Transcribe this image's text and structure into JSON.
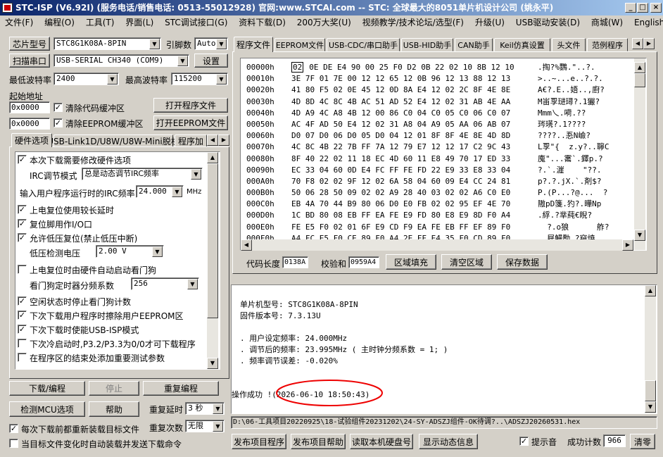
{
  "window": {
    "title": "STC-ISP (V6.92I) (服务电话/销售电话: 0513-55012928) 官网:www.STCAI.com  -- STC: 全球最大的8051单片机设计公司 (姚永平)",
    "min": "_",
    "max": "□",
    "close": "×"
  },
  "menu": [
    "文件(F)",
    "编程(O)",
    "工具(T)",
    "界面(L)",
    "STC调试接口(G)",
    "资料下载(D)",
    "200万大奖(U)",
    "视频教学/技术论坛/选型(F)",
    "升级(U)",
    "USB驱动安装(D)",
    "商城(W)",
    "English"
  ],
  "left": {
    "chip_btn": "芯片型号",
    "chip_value": "STC8G1K08A-8PIN",
    "pins_label": "引脚数",
    "pins_value": "Auto",
    "scan_btn": "扫描串口",
    "port_value": "USB-SERIAL CH340 (COM9)",
    "settings_btn": "设置",
    "min_baud_label": "最低波特率",
    "min_baud": "2400",
    "max_baud_label": "最高波特率",
    "max_baud": "115200",
    "start_addr_label": "起始地址",
    "addr1": "0x0000",
    "clear_code": "清除代码缓冲区",
    "open_prog": "打开程序文件",
    "addr2": "0x0000",
    "clear_eeprom": "清除EEPROM缓冲区",
    "open_eeprom": "打开EEPROM文件",
    "tabs": [
      "硬件选项",
      "USB-Link1D/U8W/U8W-Mini脱机",
      "程序加"
    ],
    "opt_modify": "本次下载需要修改硬件选项",
    "irc_mode_label": "IRC调节模式",
    "irc_mode": "总是动态调节IRC频率",
    "irc_freq_label": "输入用户程序运行时的IRC频率",
    "irc_freq": "24.000",
    "mhz": "MHz",
    "opt_long_delay": "上电复位使用较长延时",
    "opt_reset_io": "复位脚用作I/O口",
    "opt_low_volt": "允许低压复位(禁止低压中断)",
    "low_volt_label": "低压检测电压",
    "low_volt": "2.00 V",
    "opt_wdt": "上电复位时由硬件自动启动看门狗",
    "wdt_label": "看门狗定时器分频系数",
    "wdt_value": "256",
    "opt_idle_wdt": "空闲状态时停止看门狗计数",
    "opt_erase_eeprom": "下次下载用户程序时擦除用户EEPROM区",
    "opt_usb_isp": "下次下载时使能USB-ISP模式",
    "opt_cold": "下次冷启动时,P3.2/P3.3为0/0才可下载程序",
    "opt_end_param": "在程序区的结束处添加重要测试参数",
    "download_btn": "下载/编程",
    "stop_btn": "停止",
    "redownload_btn": "重复编程",
    "check_mcu_btn": "检测MCU选项",
    "help_btn": "帮助",
    "repeat_delay_label": "重复延时",
    "repeat_delay": "3 秒",
    "repeat_count_label": "重复次数",
    "repeat_count": "无限",
    "reload_each": "每次下载前都重新装载目标文件",
    "auto_load": "当目标文件变化时自动装载并发送下载命令"
  },
  "right": {
    "tabs": [
      "程序文件",
      "EEPROM文件",
      "USB-CDC/串口助手",
      "USB-HID助手",
      "CAN助手",
      "Keil仿真设置",
      "头文件",
      "范例程序"
    ],
    "hex_rows": [
      {
        "addr": "00000h",
        "bytes": "0E DE E4 90 00 25 F0 D2 0B 22 02 10 8B 12 10",
        "first": "02",
        "ascii": ".掏?%鸚.\"..?."
      },
      {
        "addr": "00010h",
        "bytes": "3E 7F 01 7E 00 12 12 65 12 0B 96 12 13 88 12 13",
        "ascii": ">..~...e..?.?."
      },
      {
        "addr": "00020h",
        "bytes": "41 80 F5 02 0E 45 12 0D 8A E4 12 02 2C 8F 4E 8E",
        "ascii": "A€?.E..娪..,廚?"
      },
      {
        "addr": "00030h",
        "bytes": "4D 8D 4C 8C 4B AC 51 AD 52 E4 12 02 31 AB 4E AA",
        "ascii": "M峀孠琎璕?.1玁?"
      },
      {
        "addr": "00040h",
        "bytes": "4D A9 4C A8 4B 12 00 86 C0 04 C0 05 C0 06 C0 07",
        "ascii": "Mmm乀.嗬.??"
      },
      {
        "addr": "00050h",
        "bytes": "AC 4F AD 50 E4 12 02 31 A8 04 A9 05 AA 06 AB 07",
        "ascii": "琌璓?.1????"
      },
      {
        "addr": "00060h",
        "bytes": "D0 07 D0 06 D0 05 D0 04 12 01 8F 8F 4E 8E 4D 8D",
        "ascii": "????..忢N嶮?"
      },
      {
        "addr": "00070h",
        "bytes": "4C 8C 4B 22 7B FF 7A 12 79 E7 12 12 17 C2 9C 43",
        "ascii": "L孠\"{  z.y?..聹C"
      },
      {
        "addr": "00080h",
        "bytes": "8F 40 22 02 11 18 EC 4D 60 11 E8 49 70 17 ED 33",
        "ascii": "廆\"...霱`.鐸p.?"
      },
      {
        "addr": "00090h",
        "bytes": "EC 33 04 60 0D E4 FC FF FE FD 22 E9 33 E8 33 04",
        "ascii": "?.`.漄    \"??."
      },
      {
        "addr": "000A0h",
        "bytes": "70 F8 02 02 9F 12 02 6A 58 04 60 09 E4 CC 24 81",
        "ascii": "p?.?.jX.`.剤$?"
      },
      {
        "addr": "000B0h",
        "bytes": "50 06 28 50 09 02 02 A9 28 40 03 02 02 A6 C0 E0",
        "ascii": "P.(P...?@...  ?"
      },
      {
        "addr": "000C0h",
        "bytes": "EB 4A 70 44 B9 80 06 D0 E0 FB 02 02 95 EF 4E 70",
        "ascii": "隞pD箋.犳?.曄Np"
      },
      {
        "addr": "000D0h",
        "bytes": "1C BD 80 08 EB FF EA FE E9 FD 80 E8 E9 8D F0 A4",
        "ascii": ".綒.?丵蒓€睨?"
      },
      {
        "addr": "000E0h",
        "bytes": "FE E5 F0 02 01 6F E9 CD F9 EA FE EB FF EF 89 F0",
        "ascii": "  ?.o狼      舴?"
      },
      {
        "addr": "000F0h",
        "bytes": "A4 FC E5 F0 CE 89 F0 A4 2E FF E4 35 F0 CD 89 F0",
        "ascii": "  屣鰻勪.?窺焼"
      }
    ],
    "code_len_label": "代码长度",
    "code_len": "0138A",
    "checksum_label": "校验和",
    "checksum": "0959A4",
    "fill_btn": "区域填充",
    "clear_btn": "清空区域",
    "save_btn": "保存数据",
    "log": {
      "mcu_model": "单片机型号: STC8G1K08A-8PIN",
      "fw_ver": "固件版本号: 7.3.13U",
      "set_freq": ". 用户设定频率: 24.000MHz",
      "adj_freq": ". 调节后的频率: 23.995MHz ( 主时钟分频系数 = 1; )",
      "freq_err": ". 频率调节误差: -0.020%",
      "result": "操作成功 !(2026-06-10 18:50:43)"
    },
    "file_path": "D:\\06-工具项目20220925\\18-试验组件20231202\\24-SY-ADSZJ组件-OK待调?..\\ADSZJ20260531.hex",
    "publish_prog_btn": "发布项目程序",
    "publish_help_btn": "发布项目帮助",
    "read_serial_btn": "读取本机硬盘号",
    "show_dyn_btn": "显示动态信息",
    "beep_label": "提示音",
    "success_label": "成功计数",
    "success_count": "966",
    "clear_count_btn": "清零"
  }
}
